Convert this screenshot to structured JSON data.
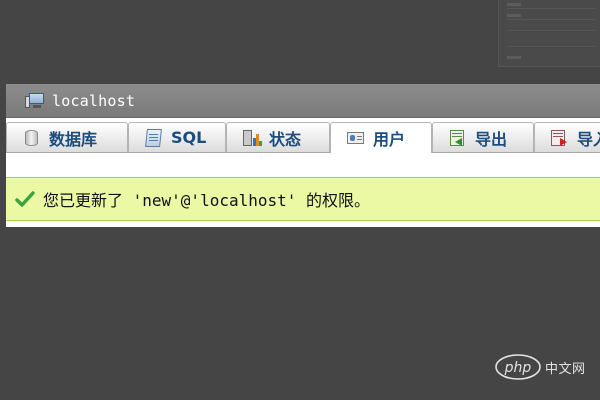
{
  "title_bar": {
    "server_name": "localhost",
    "icon": "server-icon"
  },
  "tabs": [
    {
      "label": "数据库",
      "icon": "database-icon",
      "active": false
    },
    {
      "label": "SQL",
      "icon": "sql-icon",
      "active": false
    },
    {
      "label": "状态",
      "icon": "status-icon",
      "active": false
    },
    {
      "label": "用户",
      "icon": "users-icon",
      "active": true
    },
    {
      "label": "导出",
      "icon": "export-icon",
      "active": false
    },
    {
      "label": "导入",
      "icon": "import-icon",
      "active": false
    }
  ],
  "message": {
    "text": "您已更新了 'new'@'localhost' 的权限。",
    "icon": "check-icon",
    "colors": {
      "background": "#ebf8a4",
      "border": "#a2d246",
      "check": "#3ea33e"
    }
  },
  "watermark": {
    "logo_text": "php",
    "text": "中文网"
  },
  "colors": {
    "page_background": "#454545",
    "title_bar": "#818181",
    "tab_text": "#1d4d7e"
  }
}
